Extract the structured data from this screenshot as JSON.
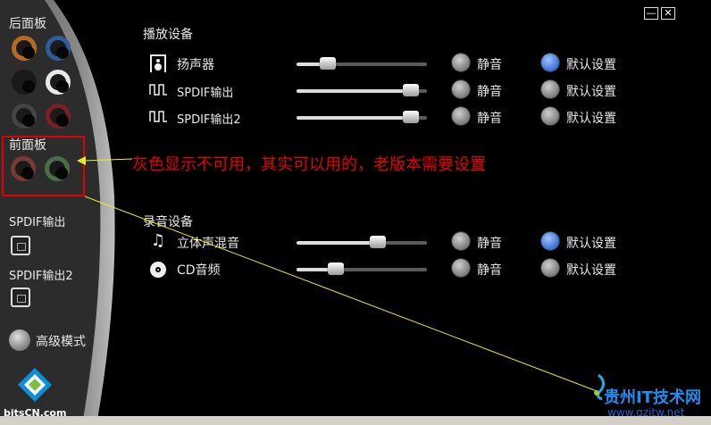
{
  "window": {
    "minimize": "—",
    "close": "✕"
  },
  "left": {
    "rear_panel": "后面板",
    "front_panel": "前面板",
    "spdif_out": "SPDIF输出",
    "spdif_out2": "SPDIF输出2",
    "advanced_mode": "高级模式"
  },
  "playback": {
    "title": "播放设备",
    "devices": [
      {
        "name": "扬声器",
        "mute": "静音",
        "default": "默认设置",
        "level": 0.2,
        "default_on": true
      },
      {
        "name": "SPDIF输出",
        "mute": "静音",
        "default": "默认设置",
        "level": 0.93,
        "default_on": false
      },
      {
        "name": "SPDIF输出2",
        "mute": "静音",
        "default": "默认设置",
        "level": 0.93,
        "default_on": false
      }
    ]
  },
  "recording": {
    "title": "录音设备",
    "devices": [
      {
        "name": "立体声混音",
        "mute": "静音",
        "default": "默认设置",
        "level": 0.64,
        "default_on": true
      },
      {
        "name": "CD音频",
        "mute": "静音",
        "default": "默认设置",
        "level": 0.27,
        "default_on": false
      }
    ]
  },
  "annotation": "灰色显示不可用，其实可以用的，老版本需要设置",
  "watermark": {
    "left": "bitsCN.com",
    "right_title": "贵州IT技术网",
    "right_url": "www.gzitw.net"
  },
  "colors": {
    "accent": "#3b6fd1",
    "annotation": "#e60000"
  },
  "icons": [
    "speaker-icon",
    "spdif-wave-icon",
    "music-note-icon",
    "cd-icon"
  ]
}
